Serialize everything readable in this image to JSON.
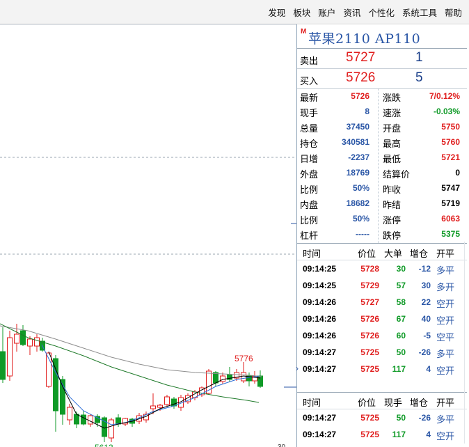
{
  "menu": [
    "发现",
    "板块",
    "账户",
    "资讯",
    "个性化",
    "系统工具",
    "帮助"
  ],
  "instrument": {
    "badge": "M",
    "name": "苹果2110  AP110"
  },
  "ask": {
    "label": "卖出",
    "price": "5727",
    "volume": "1"
  },
  "bid": {
    "label": "买入",
    "price": "5726",
    "volume": "5"
  },
  "stats": [
    {
      "l1": "最新",
      "v1": "5726",
      "c1": "red",
      "l2": "涨跌",
      "v2": "7/0.12%",
      "c2": "red"
    },
    {
      "l1": "现手",
      "v1": "8",
      "c1": "blue",
      "l2": "速涨",
      "v2": "-0.03%",
      "c2": "green"
    },
    {
      "l1": "总量",
      "v1": "37450",
      "c1": "blue",
      "l2": "开盘",
      "v2": "5750",
      "c2": "red"
    },
    {
      "l1": "持仓",
      "v1": "340581",
      "c1": "blue",
      "l2": "最高",
      "v2": "5760",
      "c2": "red"
    },
    {
      "l1": "日增",
      "v1": "-2237",
      "c1": "blue",
      "l2": "最低",
      "v2": "5721",
      "c2": "red"
    },
    {
      "l1": "外盘",
      "v1": "18769",
      "c1": "blue",
      "l2": "结算价",
      "v2": "0",
      "c2": "black"
    },
    {
      "l1": "比例",
      "v1": "50%",
      "c1": "blue",
      "l2": "昨收",
      "v2": "5747",
      "c2": "black"
    },
    {
      "l1": "内盘",
      "v1": "18682",
      "c1": "blue",
      "l2": "昨结",
      "v2": "5719",
      "c2": "black"
    },
    {
      "l1": "比例",
      "v1": "50%",
      "c1": "blue",
      "l2": "涨停",
      "v2": "6063",
      "c2": "red"
    },
    {
      "l1": "杠杆",
      "v1": "-----",
      "c1": "blue",
      "l2": "跌停",
      "v2": "5375",
      "c2": "green"
    }
  ],
  "ticks1": {
    "headers": [
      "时间",
      "价位",
      "大单",
      "增仓",
      "开平"
    ],
    "rows": [
      {
        "t": "09:14:25",
        "p": "5728",
        "v": "30",
        "o": "-12",
        "k": "多平",
        "kc": "blue"
      },
      {
        "t": "09:14:25",
        "p": "5729",
        "v": "57",
        "o": "30",
        "k": "多开",
        "kc": "blue"
      },
      {
        "t": "09:14:26",
        "p": "5727",
        "v": "58",
        "o": "22",
        "k": "空开",
        "kc": "blue"
      },
      {
        "t": "09:14:26",
        "p": "5726",
        "v": "67",
        "o": "40",
        "k": "空开",
        "kc": "blue"
      },
      {
        "t": "09:14:26",
        "p": "5726",
        "v": "60",
        "o": "-5",
        "k": "空平",
        "kc": "blue"
      },
      {
        "t": "09:14:27",
        "p": "5725",
        "v": "50",
        "o": "-26",
        "k": "多平",
        "kc": "blue"
      },
      {
        "t": "09:14:27",
        "p": "5725",
        "v": "117",
        "o": "4",
        "k": "空开",
        "kc": "blue"
      }
    ]
  },
  "ticks2": {
    "headers": [
      "时间",
      "价位",
      "现手",
      "增仓",
      "开平"
    ],
    "rows": [
      {
        "t": "09:14:27",
        "p": "5725",
        "v": "50",
        "o": "-26",
        "k": "多平",
        "kc": "blue"
      },
      {
        "t": "09:14:27",
        "p": "5725",
        "v": "117",
        "o": "4",
        "k": "空开",
        "kc": "blue"
      }
    ]
  },
  "chart_labels": {
    "high": "5776",
    "low": "5613",
    "period": "30"
  },
  "colors": {
    "up": "#e01e1e",
    "down": "#0f9a27",
    "ma1": "#000000",
    "ma2": "#2f6fd6",
    "ma3": "#1f7a2a",
    "ma4": "#8d8d8d"
  }
}
